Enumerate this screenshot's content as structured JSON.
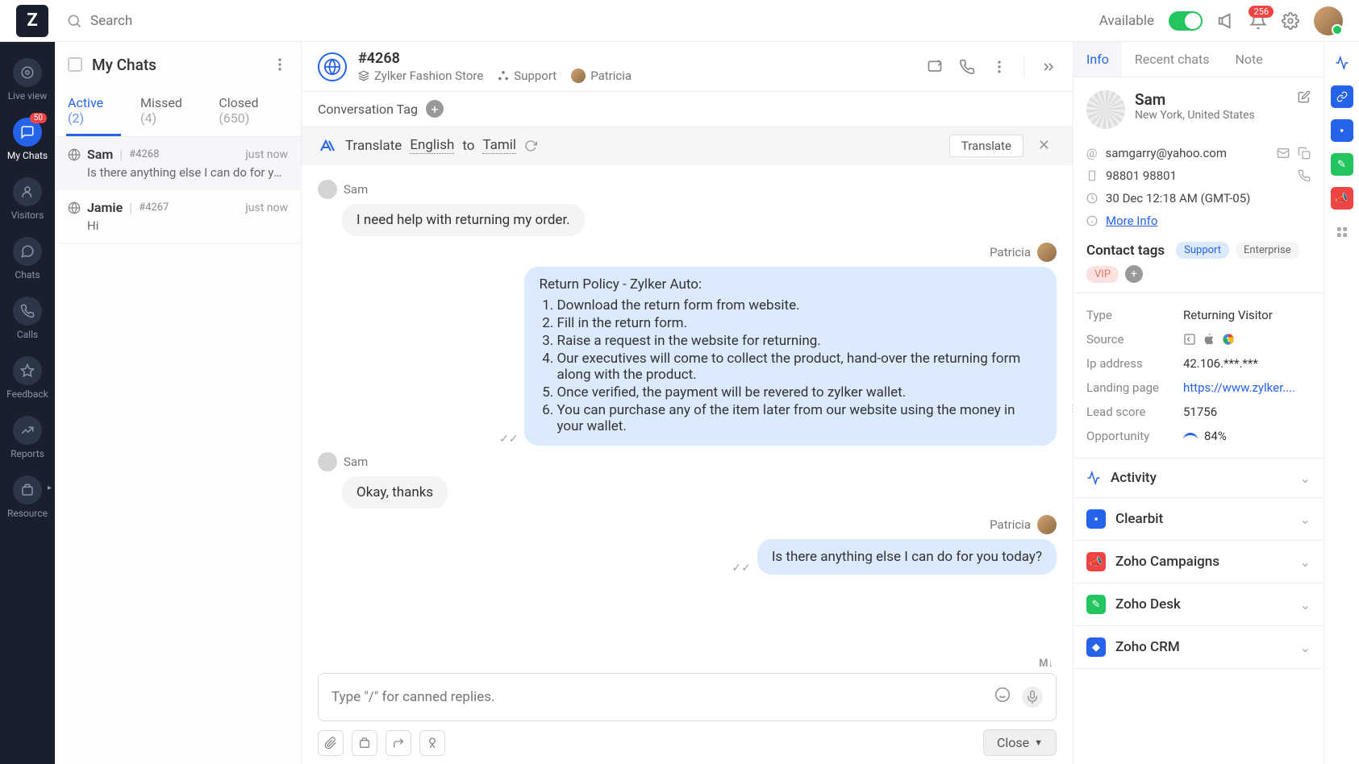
{
  "topbar": {
    "search_placeholder": "Search",
    "availability": "Available",
    "notification_count": "256"
  },
  "leftnav": {
    "items": [
      {
        "label": "Live view"
      },
      {
        "label": "My Chats",
        "badge": "50"
      },
      {
        "label": "Visitors"
      },
      {
        "label": "Chats"
      },
      {
        "label": "Calls"
      },
      {
        "label": "Feedback"
      },
      {
        "label": "Reports"
      },
      {
        "label": "Resource"
      }
    ]
  },
  "chatlist": {
    "title": "My Chats",
    "tabs": {
      "active_label": "Active",
      "active_count": "(2)",
      "missed_label": "Missed",
      "missed_count": "(4)",
      "closed_label": "Closed",
      "closed_count": "(650)"
    },
    "items": [
      {
        "name": "Sam",
        "id": "#4268",
        "time": "just now",
        "preview": "Is there anything else I can do for yo..."
      },
      {
        "name": "Jamie",
        "id": "#4267",
        "time": "just now",
        "preview": "Hi"
      }
    ]
  },
  "conversation": {
    "ticket": "#4268",
    "store": "Zylker Fashion Store",
    "dept": "Support",
    "agent": "Patricia",
    "tag_label": "Conversation Tag",
    "translate": {
      "prefix": "Translate",
      "from": "English",
      "to_word": "to",
      "to": "Tamil",
      "button": "Translate"
    },
    "messages": {
      "sam_label": "Sam",
      "patricia_label": "Patricia",
      "m1": "I need help with returning my order.",
      "policy_title": "Return Policy - Zylker Auto:",
      "p1": "Download the return form from website.",
      "p2": "Fill in the return form.",
      "p3": "Raise a request in the website for returning.",
      "p4": "Our executives will come to collect the product, hand-over the returning form along with the product.",
      "p5": "Once verified, the payment will be revered to zylker wallet.",
      "p6": "You can purchase any of the item later from our website using the money in your wallet.",
      "m3": "Okay, thanks",
      "m4": "Is there anything else I can do for you today?"
    },
    "composer_placeholder": "Type \"/\" for canned replies.",
    "close_label": "Close"
  },
  "rightpanel": {
    "tabs": {
      "info": "Info",
      "recent": "Recent chats",
      "note": "Note"
    },
    "profile": {
      "name": "Sam",
      "location": "New York, United States"
    },
    "email": "samgarry@yahoo.com",
    "phone": "98801 98801",
    "timestamp": "30 Dec 12:18 AM (GMT-05)",
    "more_info": "More Info",
    "contact_tags_label": "Contact tags",
    "tags": {
      "support": "Support",
      "enterprise": "Enterprise",
      "vip": "VIP"
    },
    "details": {
      "type_label": "Type",
      "type_value": "Returning Visitor",
      "source_label": "Source",
      "ip_label": "Ip address",
      "ip_value": "42.106.***.***",
      "landing_label": "Landing page",
      "landing_value": "https://www.zylker....",
      "lead_label": "Lead score",
      "lead_value": "51756",
      "opp_label": "Opportunity",
      "opp_value": "84%"
    },
    "accordions": {
      "activity": "Activity",
      "clearbit": "Clearbit",
      "campaigns": "Zoho Campaigns",
      "desk": "Zoho Desk",
      "crm": "Zoho CRM"
    }
  }
}
